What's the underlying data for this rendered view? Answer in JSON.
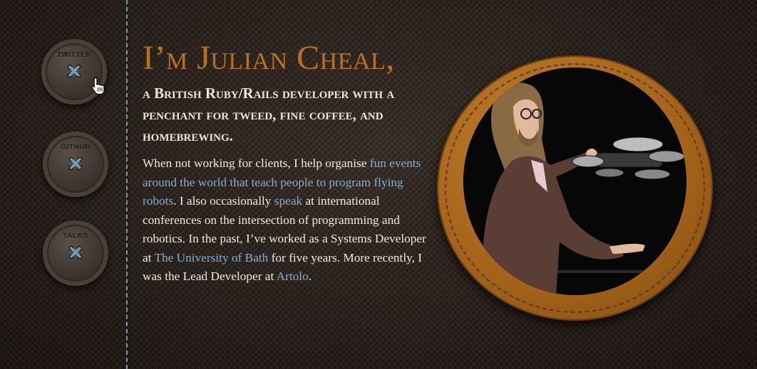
{
  "nav": {
    "buttons": [
      {
        "label": "TWITTER"
      },
      {
        "label": "GITHUB"
      },
      {
        "label": "TALKS"
      }
    ]
  },
  "intro": {
    "heading": "I’m Julian Cheal,",
    "tagline": "a British Ruby/Rails developer with a penchant for tweed, fine coffee, and homebrewing."
  },
  "bio": {
    "t1": "When not working for clients, I help organise ",
    "link_fun": "fun events around the world that teach people to program flying robots",
    "t2": ". I also occasionally ",
    "link_speak": "speak",
    "t3": " at international conferences on the intersection of programming and robotics. In the past, I’ve worked as a Systems Developer at ",
    "link_bath": "The University of Bath",
    "t4": " for five years. More recently, I was the Lead Developer at ",
    "link_artolo": "Artolo",
    "t5": "."
  },
  "colors": {
    "heading": "#b8731f",
    "link": "#7fb0d4",
    "text": "#f3e9da",
    "stitch": "#7fb7d6",
    "frame": "#a5641b"
  },
  "icons": [
    "button-holes-icon",
    "pointer-cursor-icon"
  ]
}
